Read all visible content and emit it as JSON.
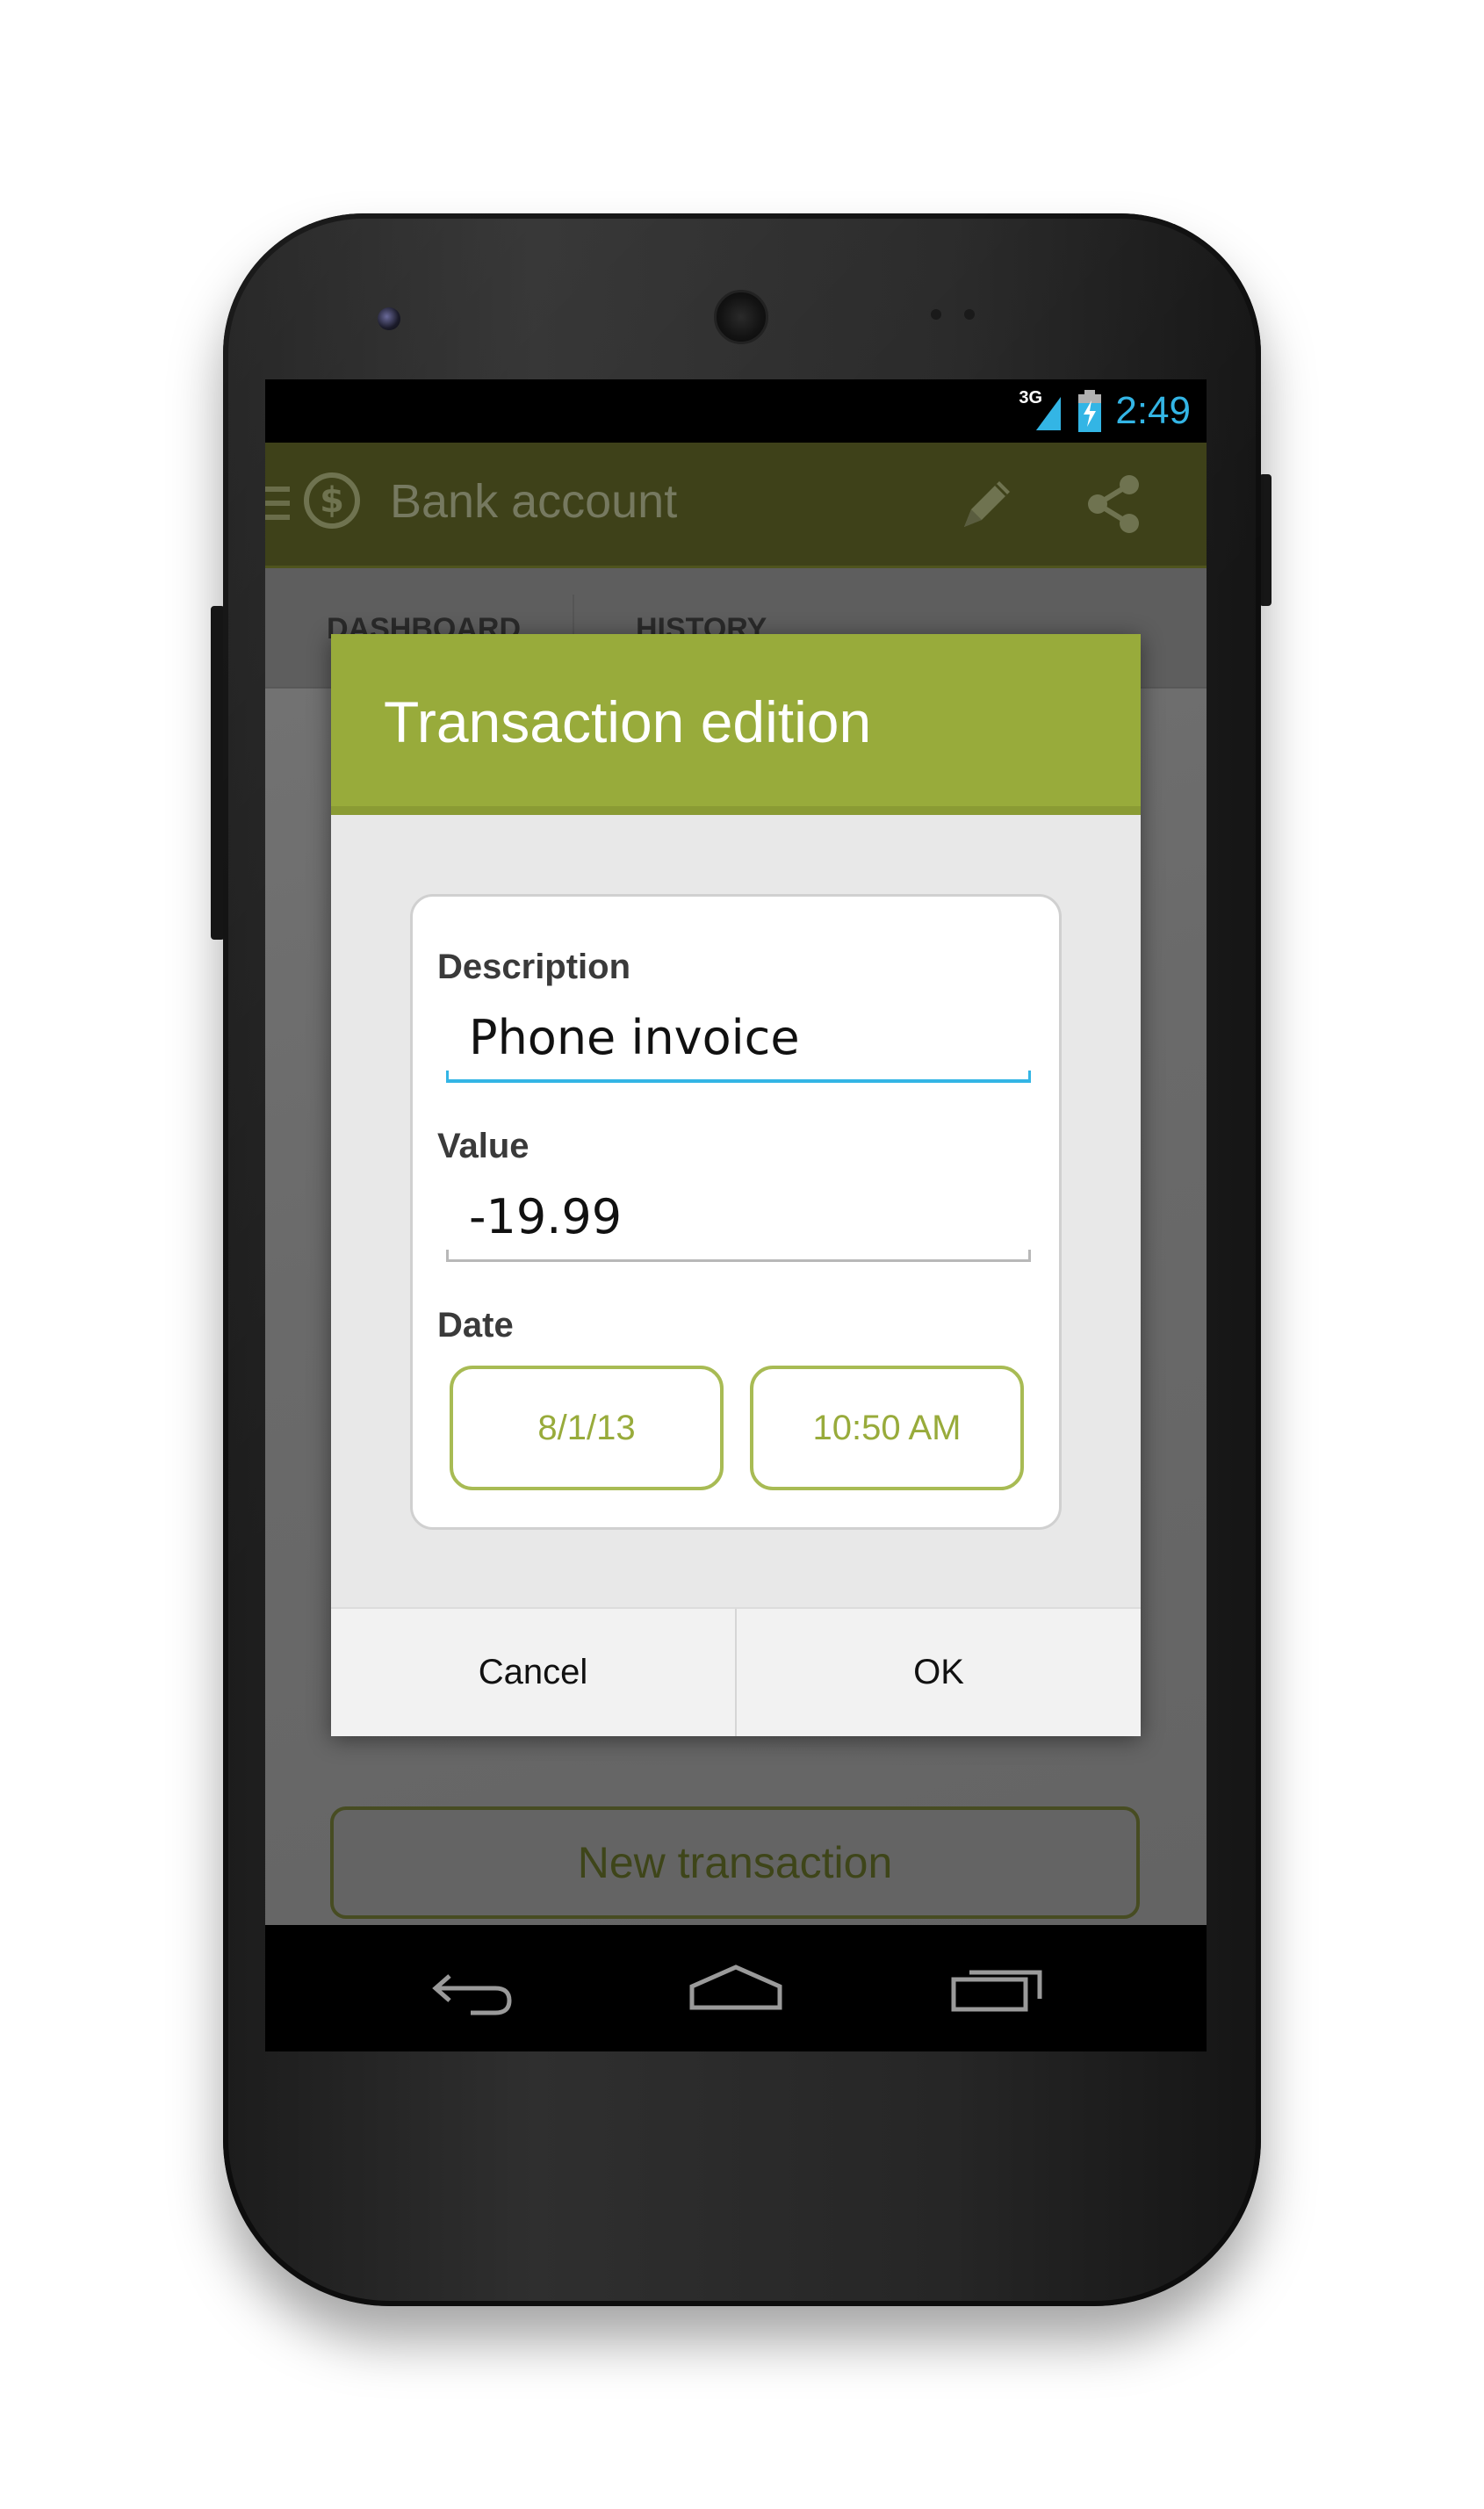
{
  "status_bar": {
    "network": "3G",
    "time": "2:49"
  },
  "action_bar": {
    "title": "Bank account",
    "menu_icon": "menu-icon",
    "logo_icon": "dollar-icon",
    "logo_symbol": "$",
    "actions": [
      "pencil-icon",
      "share-icon"
    ]
  },
  "tabs": [
    {
      "label": "DASHBOARD"
    },
    {
      "label": "HISTORY"
    }
  ],
  "new_transaction_label": "New transaction",
  "dialog": {
    "title": "Transaction edition",
    "description": {
      "label": "Description",
      "value": "Phone invoice"
    },
    "value": {
      "label": "Value",
      "value": "-19.99"
    },
    "date": {
      "label": "Date",
      "date_value": "8/1/13",
      "time_value": "10:50 AM"
    },
    "cancel_label": "Cancel",
    "ok_label": "OK"
  },
  "colors": {
    "accent": "#98ab3b",
    "action_bar": "#3e4119",
    "input_focus": "#33b5e5",
    "status_time": "#33b5e5"
  },
  "nav_bar": [
    "back-icon",
    "home-icon",
    "recent-apps-icon"
  ]
}
